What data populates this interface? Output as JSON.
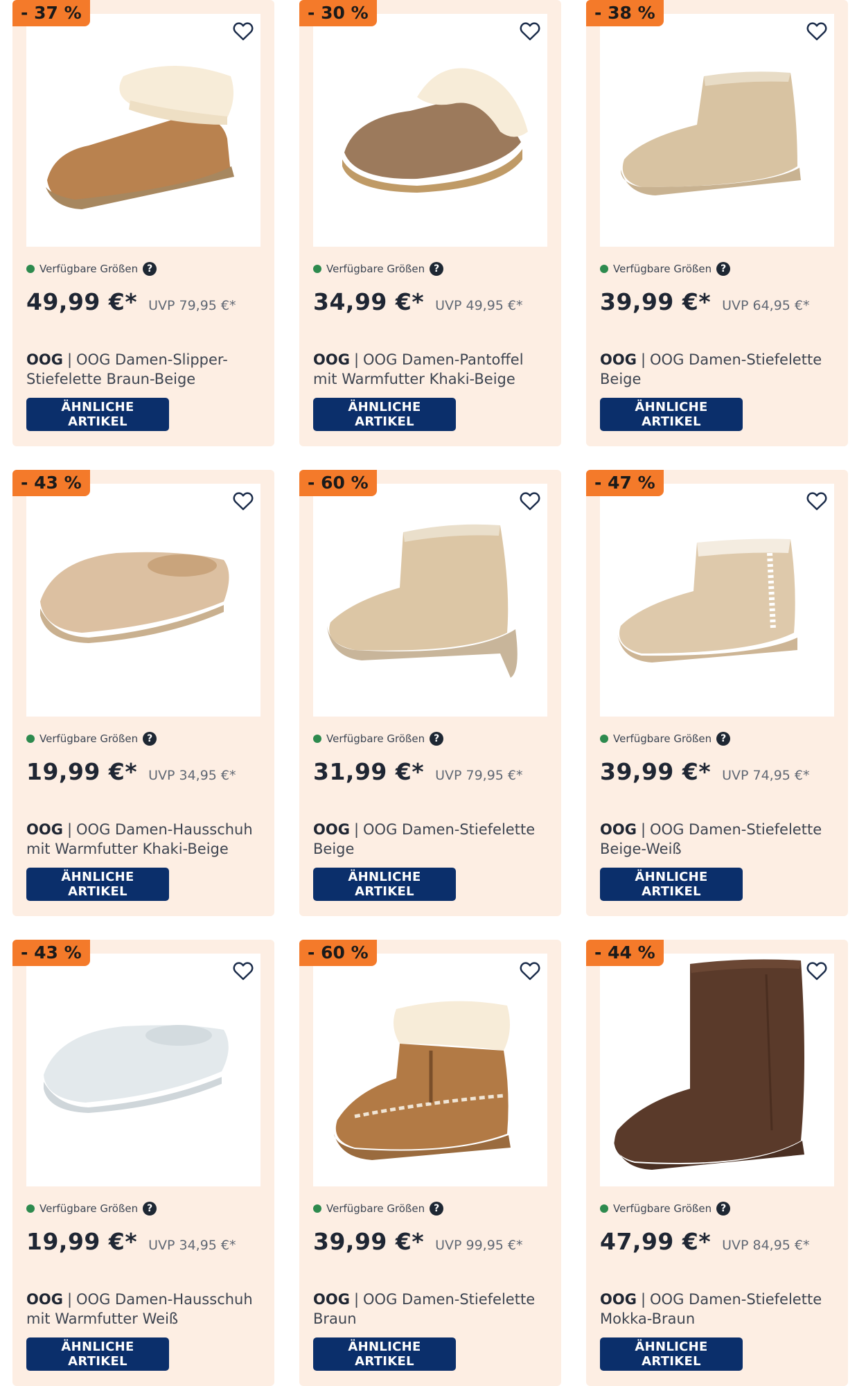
{
  "labels": {
    "sizes": "Verfügbare Größen",
    "help_glyph": "?",
    "similar_button": "ÄHNLICHE ARTIKEL",
    "separator": "|"
  },
  "colors": {
    "card_bg": "#fdeee3",
    "badge": "#f47a2a",
    "button": "#0b2f6b",
    "available_dot": "#2d8a4e"
  },
  "products": [
    {
      "discount": "- 37 %",
      "price": "49,99 €*",
      "uvp": "UVP 79,95 €*",
      "brand": "OOG",
      "name": "OOG Damen-Slipper-Stiefelette Braun-Beige",
      "icon": "slipper-bootie-fur-cuff"
    },
    {
      "discount": "- 30 %",
      "price": "34,99 €*",
      "uvp": "UVP 49,95 €*",
      "brand": "OOG",
      "name": "OOG Damen-Pantoffel mit Warmfutter Khaki-Beige",
      "icon": "slipper-mule-fur-cuff"
    },
    {
      "discount": "- 38 %",
      "price": "39,99 €*",
      "uvp": "UVP 64,95 €*",
      "brand": "OOG",
      "name": "OOG Damen-Stiefelette Beige",
      "icon": "mini-boot-beige"
    },
    {
      "discount": "- 43 %",
      "price": "19,99 €*",
      "uvp": "UVP 34,95 €*",
      "brand": "OOG",
      "name": "OOG Damen-Hausschuh mit Warmfutter Khaki-Beige",
      "icon": "teddy-slipper-beige"
    },
    {
      "discount": "- 60 %",
      "price": "31,99 €*",
      "uvp": "UVP 79,95 €*",
      "brand": "OOG",
      "name": "OOG Damen-Stiefelette Beige",
      "icon": "platform-mini-boot-beige"
    },
    {
      "discount": "- 47 %",
      "price": "39,99 €*",
      "uvp": "UVP 74,95 €*",
      "brand": "OOG",
      "name": "OOG Damen-Stiefelette Beige-Weiß",
      "icon": "mini-boot-stitched"
    },
    {
      "discount": "- 43 %",
      "price": "19,99 €*",
      "uvp": "UVP 34,95 €*",
      "brand": "OOG",
      "name": "OOG Damen-Hausschuh mit Warmfutter Weiß",
      "icon": "teddy-slipper-white"
    },
    {
      "discount": "- 60 %",
      "price": "39,99 €*",
      "uvp": "UVP 99,95 €*",
      "brand": "OOG",
      "name": "OOG Damen-Stiefelette Braun",
      "icon": "fur-boot-laced-brown"
    },
    {
      "discount": "- 44 %",
      "price": "47,99 €*",
      "uvp": "UVP 84,95 €*",
      "brand": "OOG",
      "name": "OOG Damen-Stiefelette Mokka-Braun",
      "icon": "tall-boot-mocha"
    }
  ]
}
